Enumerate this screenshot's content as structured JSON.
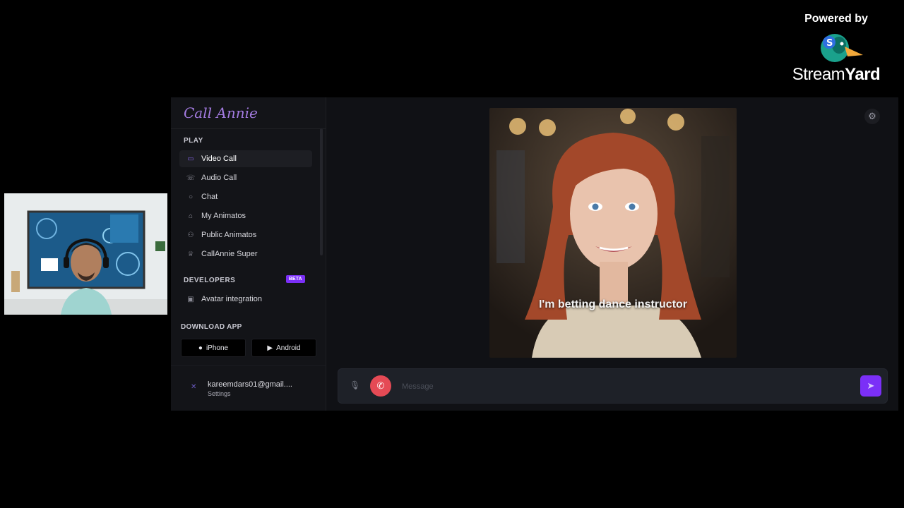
{
  "branding": {
    "powered_by": "Powered by",
    "name_light": "Stream",
    "name_bold": "Yard"
  },
  "app": {
    "title": "Call Annie"
  },
  "sidebar": {
    "play_label": "PLAY",
    "play_items": [
      {
        "label": "Video Call",
        "icon": "video-icon"
      },
      {
        "label": "Audio Call",
        "icon": "phone-icon"
      },
      {
        "label": "Chat",
        "icon": "chat-icon"
      },
      {
        "label": "My Animatos",
        "icon": "robot-icon"
      },
      {
        "label": "Public Animatos",
        "icon": "people-icon"
      },
      {
        "label": "CallAnnie Super",
        "icon": "crown-icon"
      }
    ],
    "developers_label": "DEVELOPERS",
    "beta_badge": "BETA",
    "dev_items": [
      {
        "label": "Avatar integration",
        "icon": "monitor-icon"
      }
    ],
    "download_label": "DOWNLOAD APP",
    "iphone_label": "iPhone",
    "android_label": "Android",
    "user_email": "kareemdars01@gmail....",
    "user_settings": "Settings"
  },
  "video": {
    "caption": "I'm betting dance instructor"
  },
  "message": {
    "placeholder": "Message"
  },
  "colors": {
    "accent": "#7b2ff7",
    "end_call": "#e54a55",
    "title": "#a37be0"
  }
}
